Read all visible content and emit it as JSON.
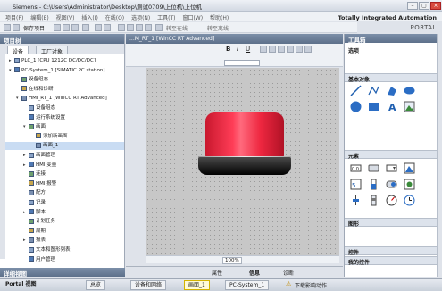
{
  "window": {
    "title": "Siemens  -  C:\\Users\\Administrator\\Desktop\\测试0709\\上位机\\上位机"
  },
  "menu": [
    "项目(P)",
    "编辑(E)",
    "视图(V)",
    "插入(I)",
    "在线(O)",
    "选项(N)",
    "工具(T)",
    "窗口(W)",
    "帮助(H)"
  ],
  "toolbar": {
    "save_label": "保存项目",
    "online_label": "转至在线",
    "offline_label": "转至离线"
  },
  "brand": {
    "line1": "Totally Integrated Automation",
    "line2": "PORTAL"
  },
  "tree": {
    "header": "项目树",
    "tabs": [
      "设备",
      "工厂对象"
    ],
    "rows": [
      {
        "label": "PLC_1 [CPU 1212C DC/DC/DC]",
        "indent": 0,
        "exp": "▸"
      },
      {
        "label": "PC-System_1 [SIMATIC PC station]",
        "indent": 0,
        "exp": "▾"
      },
      {
        "label": "设备组态",
        "indent": 1,
        "exp": ""
      },
      {
        "label": "在线和诊断",
        "indent": 1,
        "exp": ""
      },
      {
        "label": "HMI_RT_1 [WinCC RT Advanced]",
        "indent": 1,
        "exp": "▾"
      },
      {
        "label": "设备组态",
        "indent": 2,
        "exp": ""
      },
      {
        "label": "运行系统设置",
        "indent": 2,
        "exp": ""
      },
      {
        "label": "画面",
        "indent": 2,
        "exp": "▾"
      },
      {
        "label": "添加新画面",
        "indent": 3,
        "exp": ""
      },
      {
        "label": "画面_1",
        "indent": 3,
        "exp": ""
      },
      {
        "label": "画面管理",
        "indent": 2,
        "exp": "▸"
      },
      {
        "label": "HMI 变量",
        "indent": 2,
        "exp": "▸"
      },
      {
        "label": "连接",
        "indent": 2,
        "exp": ""
      },
      {
        "label": "HMI 报警",
        "indent": 2,
        "exp": ""
      },
      {
        "label": "配方",
        "indent": 2,
        "exp": ""
      },
      {
        "label": "记录",
        "indent": 2,
        "exp": ""
      },
      {
        "label": "脚本",
        "indent": 2,
        "exp": "▸"
      },
      {
        "label": "计划任务",
        "indent": 2,
        "exp": ""
      },
      {
        "label": "周期",
        "indent": 2,
        "exp": ""
      },
      {
        "label": "报表",
        "indent": 2,
        "exp": "▸"
      },
      {
        "label": "文本和图形列表",
        "indent": 2,
        "exp": ""
      },
      {
        "label": "用户管理",
        "indent": 2,
        "exp": ""
      }
    ],
    "selected_index": 9,
    "detail_label": "详细视图"
  },
  "editor": {
    "tab_title": "...M_RT_1 [WinCC RT Advanced]",
    "zoom": "100%"
  },
  "props_bar": {
    "properties": "属性",
    "info": "信息",
    "diagnostics": "诊断"
  },
  "toolbox": {
    "header": "工具箱",
    "options_label": "选项",
    "basic_objects": "基本对象",
    "elements": "元素",
    "graphics": "图形",
    "controls": "控件",
    "my_controls": "我的控件"
  },
  "taskbar": {
    "portal_view": "Portal 视图",
    "overview": "总览",
    "devices": "设备和网络",
    "screen": "画面_1",
    "pc_system": "PC-System_1",
    "status": "下载影响动作..."
  },
  "colors": {
    "header_blue": "#6a7e98",
    "lamp_red": "#ff3d57",
    "canvas_gray": "#c7c7c7"
  }
}
